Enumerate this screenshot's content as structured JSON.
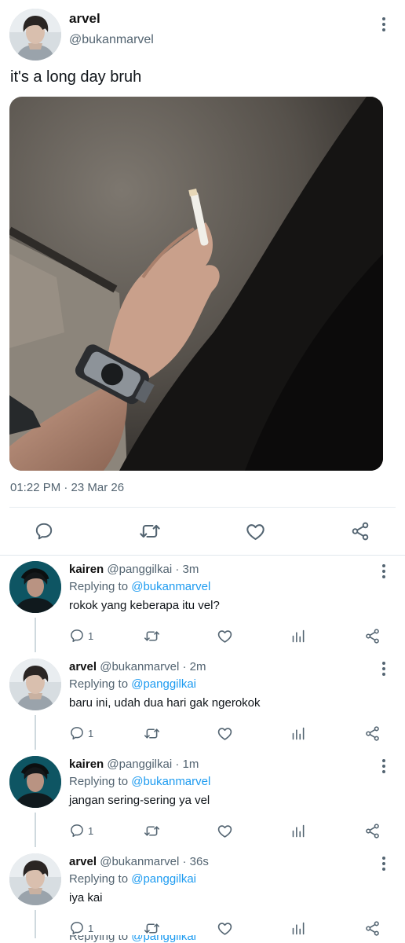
{
  "tweet": {
    "name": "arvel",
    "handle": "@bukanmarvel",
    "text": "it's a long day bruh",
    "timestamp": "01:22 PM · 23 Mar 26"
  },
  "icons": {
    "more": "more-vertical-icon",
    "reply": "speech-bubble-icon",
    "retweet": "retweet-icon",
    "like": "heart-icon",
    "share": "share-icon",
    "views": "bar-chart-icon"
  },
  "colors": {
    "link": "#1d9bf0",
    "secondary_text": "#536471",
    "divider": "#e6ecf0"
  },
  "replies": [
    {
      "name": "kairen",
      "meta": "@panggilkai · 3m",
      "replying_label": "Replying to",
      "replying_to": "@bukanmarvel",
      "text": "rokok yang keberapa itu vel?",
      "reply_count": "1"
    },
    {
      "name": "arvel",
      "meta": "@bukanmarvel · 2m",
      "replying_label": "Replying to",
      "replying_to": "@panggilkai",
      "text": "baru ini, udah dua hari gak ngerokok",
      "reply_count": "1"
    },
    {
      "name": "kairen",
      "meta": "@panggilkai · 1m",
      "replying_label": "Replying to",
      "replying_to": "@bukanmarvel",
      "text": "jangan sering-sering ya vel",
      "reply_count": "1"
    },
    {
      "name": "arvel",
      "meta": "@bukanmarvel · 36s",
      "replying_label": "Replying to",
      "replying_to": "@panggilkai",
      "text": "iya kai",
      "reply_count": "1"
    }
  ],
  "cut_reply": {
    "replying_label": "Replying to",
    "replying_to": "@panggilkai"
  }
}
